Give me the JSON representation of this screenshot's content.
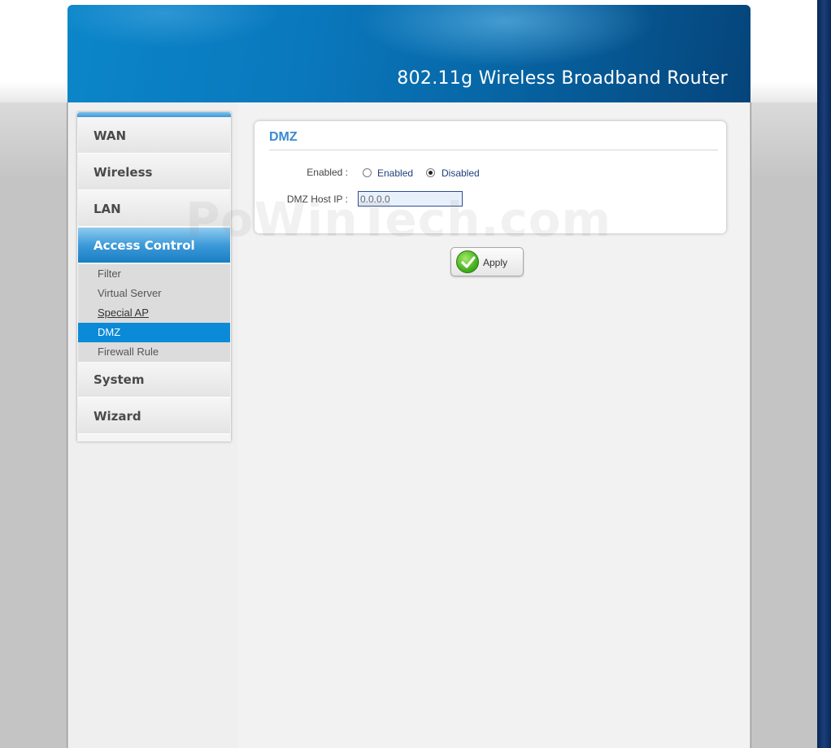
{
  "header": {
    "title": "802.11g Wireless Broadband Router"
  },
  "watermark": "PoWinTech.com",
  "sidebar": {
    "items": [
      {
        "label": "WAN"
      },
      {
        "label": "Wireless"
      },
      {
        "label": "LAN"
      },
      {
        "label": "Access Control",
        "active": true
      },
      {
        "label": "System"
      },
      {
        "label": "Wizard"
      }
    ],
    "sub_items": [
      {
        "label": "Filter"
      },
      {
        "label": "Virtual Server"
      },
      {
        "label": "Special AP"
      },
      {
        "label": "DMZ",
        "selected": true
      },
      {
        "label": "Firewall Rule"
      }
    ]
  },
  "dmz": {
    "title": "DMZ",
    "enabled_label": "Enabled :",
    "option_enabled": "Enabled",
    "option_disabled": "Disabled",
    "selected_option": "Disabled",
    "host_ip_label": "DMZ Host IP :",
    "host_ip_value": "0.0.0.0"
  },
  "apply_button": {
    "label": "Apply"
  },
  "colors": {
    "accent": "#0b8ad8",
    "title_blue": "#3a8ad0",
    "header_blue": "#0a78bd"
  }
}
